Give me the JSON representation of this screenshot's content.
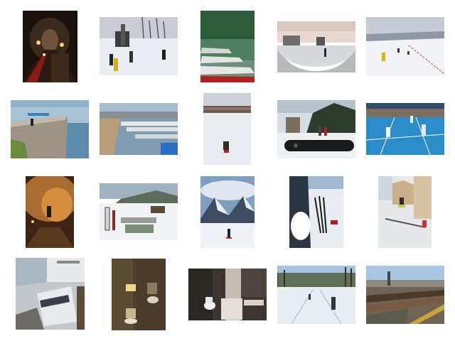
{
  "gallery": {
    "thumbnails": [
      {
        "subject": "tunnel-restaurant-candles"
      },
      {
        "subject": "ski-lift-snow-people"
      },
      {
        "subject": "lake-boats-forest"
      },
      {
        "subject": "skate-halfpipe-snow"
      },
      {
        "subject": "skier-snowy-slope"
      },
      {
        "subject": "cliff-rock-fjord"
      },
      {
        "subject": "marina-boats-city"
      },
      {
        "subject": "sledding-snow-hill"
      },
      {
        "subject": "snowboard-winter-mountain"
      },
      {
        "subject": "tennis-doubles-court"
      },
      {
        "subject": "cave-person-lantern"
      },
      {
        "subject": "ski-lodge-lounge"
      },
      {
        "subject": "skier-alpine-valley"
      },
      {
        "subject": "skis-in-snow"
      },
      {
        "subject": "snowboard-rail-street"
      },
      {
        "subject": "high-speed-train-station"
      },
      {
        "subject": "dark-bathroom"
      },
      {
        "subject": "hotel-bathroom"
      },
      {
        "subject": "cross-country-skiing"
      },
      {
        "subject": "rail-yard-trains"
      }
    ]
  }
}
